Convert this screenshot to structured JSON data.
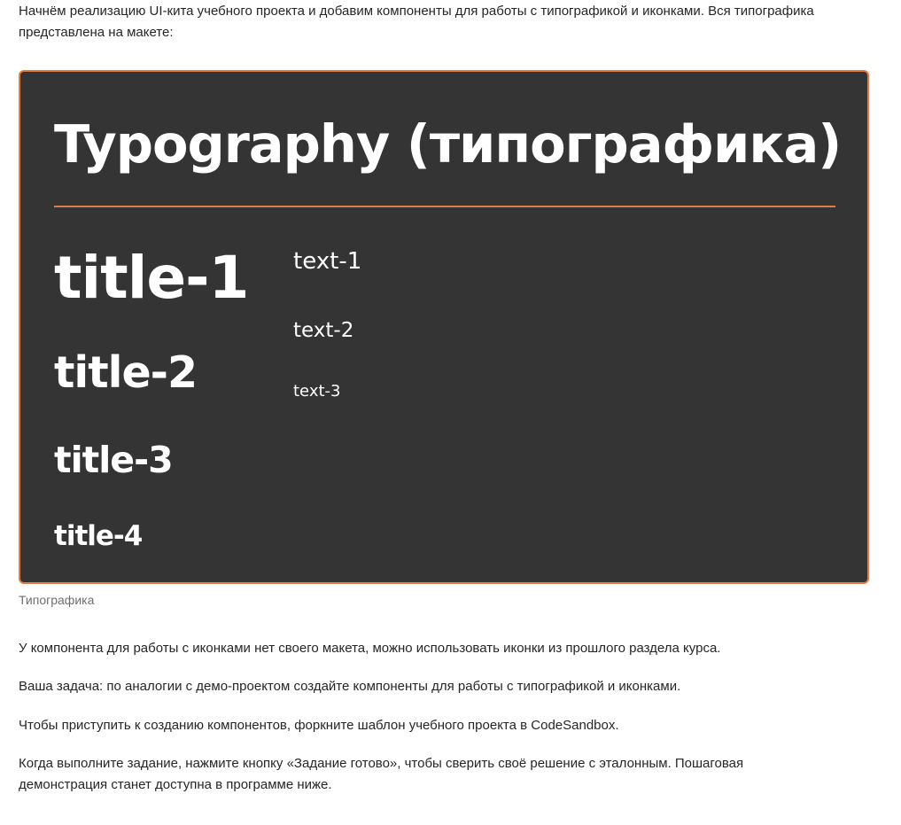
{
  "intro": "Начнём реализацию UI-кита учебного проекта и добавим компоненты для работы с типографикой и иконками. Вся типографика представлена на макете:",
  "figure": {
    "heading": "Typography (типографика)",
    "titles": [
      "title-1",
      "title-2",
      "title-3",
      "title-4"
    ],
    "texts": [
      "text-1",
      "text-2",
      "text-3"
    ],
    "caption": "Типографика"
  },
  "paragraphs": [
    "У компонента для работы с иконками нет своего макета, можно использовать иконки из прошлого раздела курса.",
    "Ваша задача: по аналогии с демо-проектом создайте компоненты для работы с типографикой и иконками.",
    "Чтобы приступить к созданию компонентов, форкните шаблон учебного проекта в CodeSandbox.",
    "Когда выполните задание, нажмите кнопку «Задание готово», чтобы сверить своё решение с эталонным. Пошаговая демонстрация станет доступна в программе ниже."
  ],
  "colors": {
    "figure_background": "#353434",
    "accent": "#e27d3f",
    "figure_text": "#ffffff",
    "body_text": "#262626",
    "caption_text": "#6f6f6f"
  }
}
